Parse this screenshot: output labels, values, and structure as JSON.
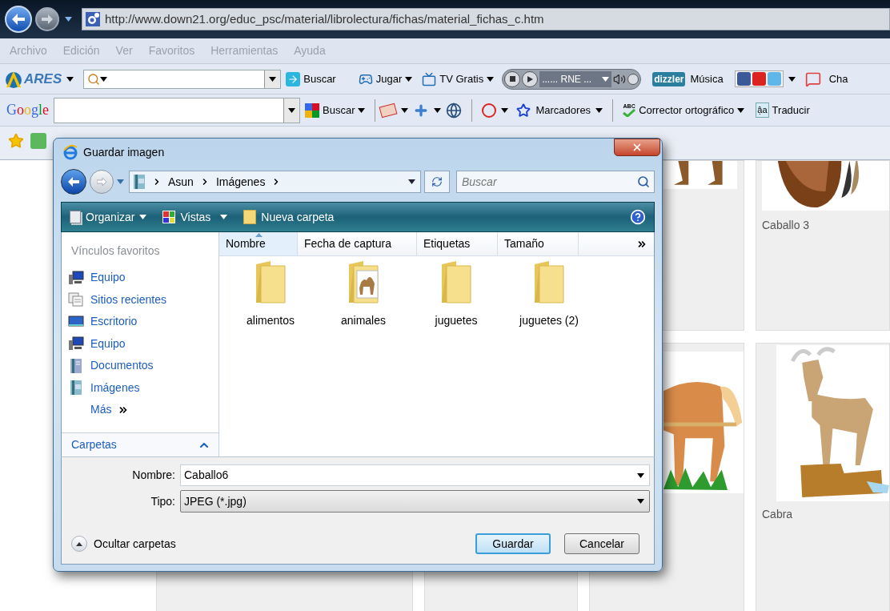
{
  "browser": {
    "address": "http://www.down21.org/educ_psc/material/librolectura/fichas/material_fichas_c.htm",
    "menu": {
      "dimmed": true,
      "items": [
        "Archivo",
        "Edición",
        "Ver",
        "Favoritos",
        "Herramientas",
        "Ayuda"
      ]
    },
    "ares_toolbar": {
      "logo": "ARES",
      "search_button": "Buscar",
      "items": [
        "Jugar",
        "TV Gratis"
      ],
      "radio_station": "...... RNE ...",
      "music_logo": "dizzler",
      "music_label": "Música",
      "chat_label": "Cha"
    },
    "google_toolbar": {
      "logo": "Google",
      "search_button": "Buscar",
      "bookmarks": "Marcadores",
      "spellcheck_icon_text": "ABC",
      "spellcheck": "Corrector ortográfico",
      "translate_icon_text": "ậa",
      "translate": "Traducir"
    }
  },
  "page": {
    "cards": [
      {
        "caption": "Caballo 3"
      },
      {
        "caption": "Cabra"
      }
    ]
  },
  "dialog": {
    "title": "Guardar imagen",
    "breadcrumb": [
      "Asun",
      "Imágenes"
    ],
    "search_placeholder": "Buscar",
    "toolbar": {
      "organize": "Organizar",
      "views": "Vistas",
      "new_folder": "Nueva carpeta"
    },
    "favorites_header": "Vínculos favoritos",
    "favorites": [
      {
        "label": "Equipo",
        "kind": "computer"
      },
      {
        "label": "Sitios recientes",
        "kind": "recent"
      },
      {
        "label": "Escritorio",
        "kind": "desktop"
      },
      {
        "label": "Equipo",
        "kind": "computer"
      },
      {
        "label": "Documentos",
        "kind": "documents"
      },
      {
        "label": "Imágenes",
        "kind": "pictures"
      },
      {
        "label": "Más",
        "kind": "more"
      }
    ],
    "folders_toggle": "Carpetas",
    "columns": [
      {
        "label": "Nombre",
        "selected": true
      },
      {
        "label": "Fecha de captura",
        "selected": false
      },
      {
        "label": "Etiquetas",
        "selected": false
      },
      {
        "label": "Tamaño",
        "selected": false
      }
    ],
    "items": [
      {
        "name": "alimentos",
        "kind": "plain"
      },
      {
        "name": "animales",
        "kind": "preview"
      },
      {
        "name": "juguetes",
        "kind": "plain"
      },
      {
        "name": "juguetes (2)",
        "kind": "plain"
      }
    ],
    "file_name_label": "Nombre:",
    "file_name": "Caballo6",
    "file_type_label": "Tipo:",
    "file_type": "JPEG (*.jpg)",
    "hide_folders": "Ocultar carpetas",
    "buttons": [
      {
        "label": "Guardar",
        "default": true
      },
      {
        "label": "Cancelar",
        "default": false
      }
    ]
  }
}
